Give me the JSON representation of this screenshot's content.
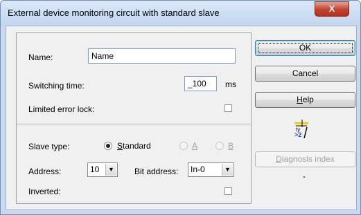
{
  "window": {
    "title": "External device monitoring circuit with standard slave",
    "close_glyph": "X"
  },
  "form": {
    "name_label": "Name:",
    "name_value": "Name",
    "switching_time_label": "Switching time:",
    "switching_time_value": "_100",
    "switching_time_unit": "ms",
    "limited_error_lock_label": "Limited error lock:",
    "limited_error_lock_checked": false,
    "slave_type_label": "Slave type:",
    "slave_type_options": [
      {
        "accel": "S",
        "rest": "tandard",
        "selected": true,
        "enabled": true
      },
      {
        "accel": "A",
        "rest": "",
        "selected": false,
        "enabled": false
      },
      {
        "accel": "B",
        "rest": "",
        "selected": false,
        "enabled": false
      }
    ],
    "address_label": "Address:",
    "address_value": "10",
    "bit_address_label": "Bit address:",
    "bit_address_value": "In-0",
    "inverted_label": "Inverted:",
    "inverted_checked": false
  },
  "buttons": {
    "ok": "OK",
    "cancel": "Cancel",
    "help_accel": "H",
    "help_rest": "elp",
    "diag_accel": "D",
    "diag_rest": "iagnosis index"
  },
  "diagnosis_value": "-",
  "icon": {
    "name": "logic-block-icon",
    "text": ">2"
  }
}
